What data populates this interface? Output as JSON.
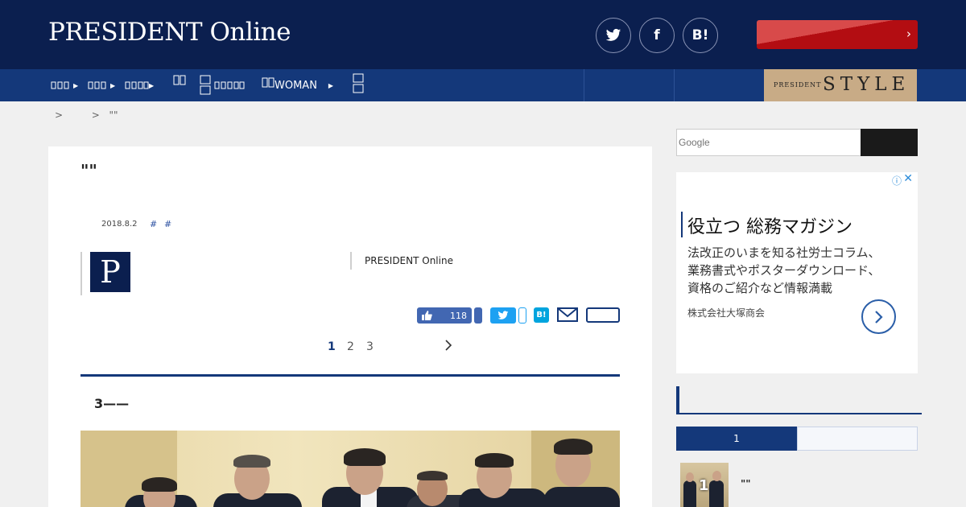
{
  "header": {
    "logo": "PRESIDENT Online",
    "social": [
      {
        "icon": "twitter-icon",
        "glyph": ""
      },
      {
        "icon": "facebook-icon",
        "glyph": "f"
      },
      {
        "icon": "hatena-bookmark-icon",
        "glyph": "B!"
      }
    ],
    "promo_icon": "chevron-right-icon",
    "colors": {
      "header": "#0b1f4f",
      "nav": "#14387a",
      "promo": "#b30d12"
    }
  },
  "nav": {
    "items": [
      {
        "label": "",
        "icon": "caret-right-icon"
      },
      {
        "label": "",
        "icon": "caret-right-icon"
      },
      {
        "label": "",
        "icon": "caret-right-icon"
      },
      {
        "label": "",
        "icon": "magazine-icon"
      },
      {
        "label": "",
        "icon": "book-icon"
      },
      {
        "label": "WOMAN",
        "icon": "magazine-icon"
      },
      {
        "label": "",
        "icon": "book-icon"
      }
    ],
    "style_small": "PRESIDENT",
    "style_big": "STYLE"
  },
  "breadcrumb": {
    "sep1": ">",
    "sep2": ">",
    "current": "\"\""
  },
  "article": {
    "title": "\"\"",
    "date": "2018.8.2",
    "tags": [
      "#",
      "#"
    ],
    "author_initial": "P",
    "author_org": "PRESIDENT Online",
    "share": {
      "like_count": "118",
      "hatena_label": "B!",
      "icons": [
        "facebook-like-icon",
        "twitter-icon",
        "hatena-bookmark-icon",
        "mail-icon",
        "save-icon"
      ]
    },
    "pagination": {
      "pages": [
        "1",
        "2",
        "3"
      ],
      "current": "1",
      "next_icon": "chevron-right-icon"
    },
    "lead": "3——"
  },
  "sidebar": {
    "search_placeholder": "Google",
    "ad": {
      "info_icon": "ⓘ",
      "close_icon": "✕",
      "title": "役立つ 総務マガジン",
      "body": [
        "法改正のいまを知る社労士コラム、",
        "業務書式やポスターダウンロード、",
        "資格のご紹介など情報満載"
      ],
      "company": "株式会社大塚商会",
      "arrow_icon": "chevron-right-icon"
    },
    "ranking": {
      "tabs": [
        "1",
        ""
      ],
      "items": [
        {
          "rank": "1",
          "title": "\"\""
        }
      ]
    }
  }
}
